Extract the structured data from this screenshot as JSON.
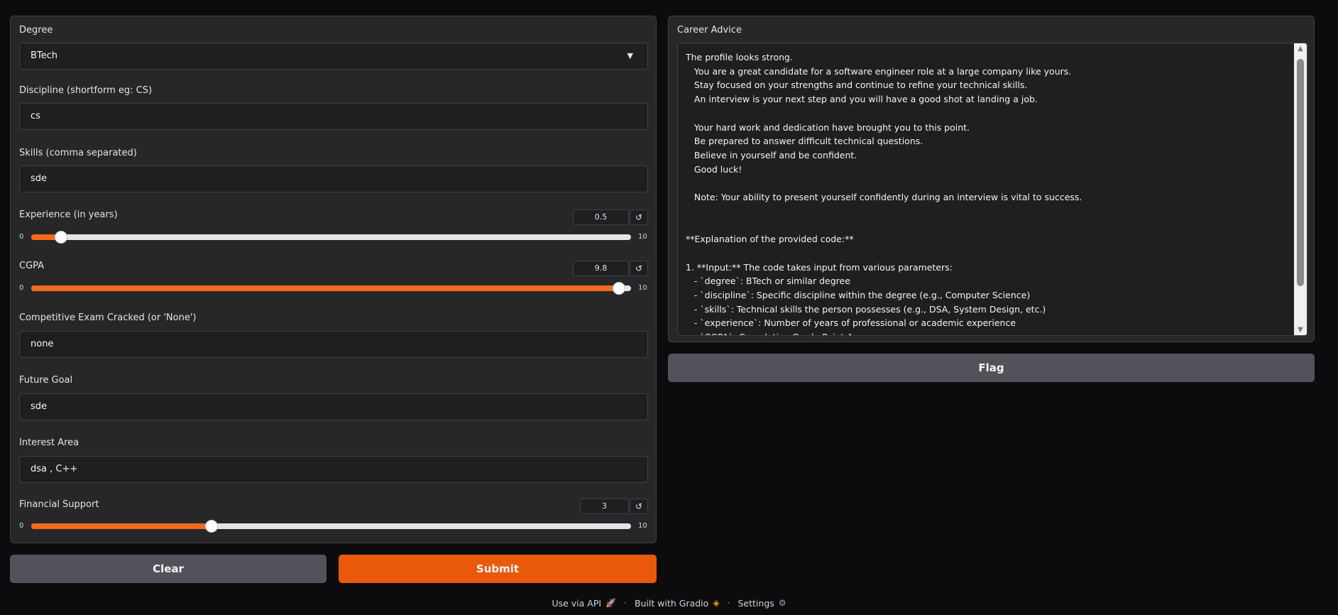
{
  "form": {
    "degree": {
      "label": "Degree",
      "value": "BTech"
    },
    "discipline": {
      "label": "Discipline (shortform eg: CS)",
      "value": "cs"
    },
    "skills": {
      "label": "Skills (comma separated)",
      "value": "sde"
    },
    "experience": {
      "label": "Experience (in years)",
      "value": "0.5",
      "min": "0",
      "max": "10",
      "fraction": 0.05
    },
    "cgpa": {
      "label": "CGPA",
      "value": "9.8",
      "min": "0",
      "max": "10",
      "fraction": 0.98
    },
    "exam": {
      "label": "Competitive Exam Cracked (or 'None')",
      "value": "none"
    },
    "goal": {
      "label": "Future Goal",
      "value": "sde"
    },
    "interest": {
      "label": "Interest Area",
      "value": "dsa , C++"
    },
    "financial": {
      "label": "Financial Support",
      "value": "3",
      "min": "0",
      "max": "10",
      "fraction": 0.3
    }
  },
  "buttons": {
    "clear": "Clear",
    "submit": "Submit",
    "flag": "Flag"
  },
  "output": {
    "label": "Career Advice",
    "text": "The profile looks strong.\n   You are a great candidate for a software engineer role at a large company like yours.\n   Stay focused on your strengths and continue to refine your technical skills.\n   An interview is your next step and you will have a good shot at landing a job.\n\n   Your hard work and dedication have brought you to this point.\n   Be prepared to answer difficult technical questions.\n   Believe in yourself and be confident.\n   Good luck!\n\n   Note: Your ability to present yourself confidently during an interview is vital to success.\n\n\n**Explanation of the provided code:**\n\n1. **Input:** The code takes input from various parameters:\n   - `degree`: BTech or similar degree\n   - `discipline`: Specific discipline within the degree (e.g., Computer Science)\n   - `skills`: Technical skills the person possesses (e.g., DSA, System Design, etc.)\n   - `experience`: Number of years of professional or academic experience\n   - `CGPA`: Cumulative Grade Point Average"
  },
  "footer": {
    "api": "Use via API",
    "built": "Built with Gradio",
    "settings": "Settings",
    "sep": "·"
  },
  "icons": {
    "reset": "↺",
    "dropdown": "▼",
    "scroll_up": "▲",
    "scroll_down": "▼",
    "rocket": "🚀",
    "gradio": "◈",
    "gear": "⚙"
  },
  "colors": {
    "accent": "#f26a1b",
    "submit": "#ea580c",
    "panel": "#27272a",
    "background": "#0c0c0f"
  }
}
